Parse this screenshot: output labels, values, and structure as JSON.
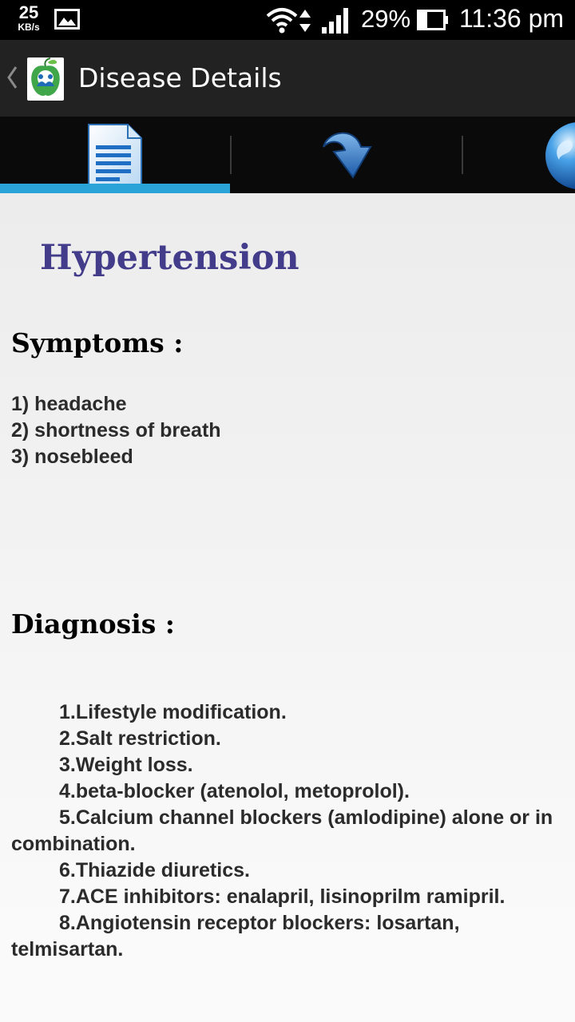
{
  "status_bar": {
    "speed_value": "25",
    "speed_unit": "KB/s",
    "battery_percent": "29%",
    "time": "11:36 pm",
    "icons": [
      "gallery-icon",
      "wifi-icon",
      "data-arrows-icon",
      "signal-icon",
      "battery-icon"
    ]
  },
  "action_bar": {
    "title": "Disease Details",
    "icons": [
      "back-icon",
      "app-logo-icon"
    ]
  },
  "tabs": [
    {
      "icon": "document-icon",
      "selected": true
    },
    {
      "icon": "redo-arrow-icon",
      "selected": false
    },
    {
      "icon": "globe-icon",
      "selected": false
    }
  ],
  "colors": {
    "tab_indicator": "#2aa4d8",
    "disease_title": "#433c8a",
    "action_bar": "#222222",
    "status_bar": "#000000"
  },
  "disease": {
    "name": "Hypertension",
    "symptoms_heading": "Symptoms :",
    "symptoms": [
      "1) headache",
      "2) shortness of breath",
      "3) nosebleed"
    ],
    "diagnosis_heading": "Diagnosis :",
    "diagnosis": [
      "1.Lifestyle modification.",
      "2.Salt restriction.",
      "3.Weight loss.",
      "4.beta-blocker (atenolol, metoprolol).",
      "5.Calcium channel blockers (amlodipine) alone or in combination.",
      "6.Thiazide diuretics.",
      "7.ACE inhibitors: enalapril, lisinoprilm ramipril.",
      "8.Angiotensin receptor blockers: losartan, telmisartan."
    ]
  }
}
